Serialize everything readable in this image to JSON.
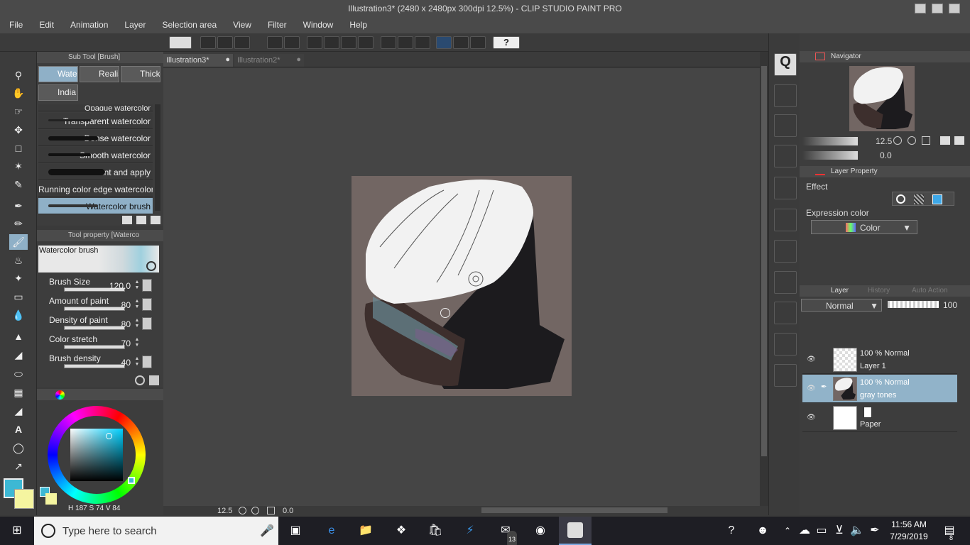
{
  "window": {
    "title": "Illustration3* (2480 x 2480px 300dpi 12.5%)  - CLIP STUDIO PAINT PRO"
  },
  "menu": [
    "File",
    "Edit",
    "Animation",
    "Layer",
    "Selection area",
    "View",
    "Filter",
    "Window",
    "Help"
  ],
  "subtool_panel": {
    "title": "Sub Tool [Brush]",
    "tabs": [
      "Water",
      "Realis",
      "Thick",
      "India"
    ],
    "brushes": [
      "Opaque watercolor",
      "Transparent watercolor",
      "Dense watercolor",
      "Smooth watercolor",
      "Paint and apply",
      "Running color edge watercolor",
      "Watercolor brush"
    ]
  },
  "tool_property": {
    "title": "Tool property [Waterco",
    "brush_name": "Watercolor brush",
    "props": [
      {
        "label": "Brush Size",
        "value": "120.0"
      },
      {
        "label": "Amount of paint",
        "value": "80"
      },
      {
        "label": "Density of paint",
        "value": "80"
      },
      {
        "label": "Color stretch",
        "value": "70"
      },
      {
        "label": "Brush density",
        "value": "40"
      }
    ]
  },
  "color": {
    "main_color": "#3db8d4",
    "sub_color": "#f5f5a0",
    "h_label": "H",
    "h": "187",
    "s_label": "S",
    "s": "74",
    "v_label": "V",
    "v": "84"
  },
  "documents": {
    "tabs": [
      "Illustration3*",
      "Illustration2*"
    ]
  },
  "status": {
    "zoom": "12.5",
    "rotation": "0.0"
  },
  "navigator": {
    "title": "Navigator",
    "zoom": "12.5",
    "rotation": "0.0"
  },
  "layer_property": {
    "title": "Layer Property",
    "effect_label": "Effect",
    "expression_color_label": "Expression color",
    "expression_color_value": "Color"
  },
  "layer_panel": {
    "tabs": [
      "Layer",
      "History",
      "Auto Action"
    ],
    "blend_mode": "Normal",
    "opacity": "100",
    "layers": [
      {
        "mode": "100 % Normal",
        "name": "Layer 1"
      },
      {
        "mode": "100 % Normal",
        "name": "gray tones"
      },
      {
        "mode": "",
        "name": "Paper"
      }
    ]
  },
  "taskbar": {
    "search_placeholder": "Type here to search",
    "time": "11:56 AM",
    "date": "7/29/2019",
    "mail_badge": "13",
    "notif_badge": "8"
  }
}
